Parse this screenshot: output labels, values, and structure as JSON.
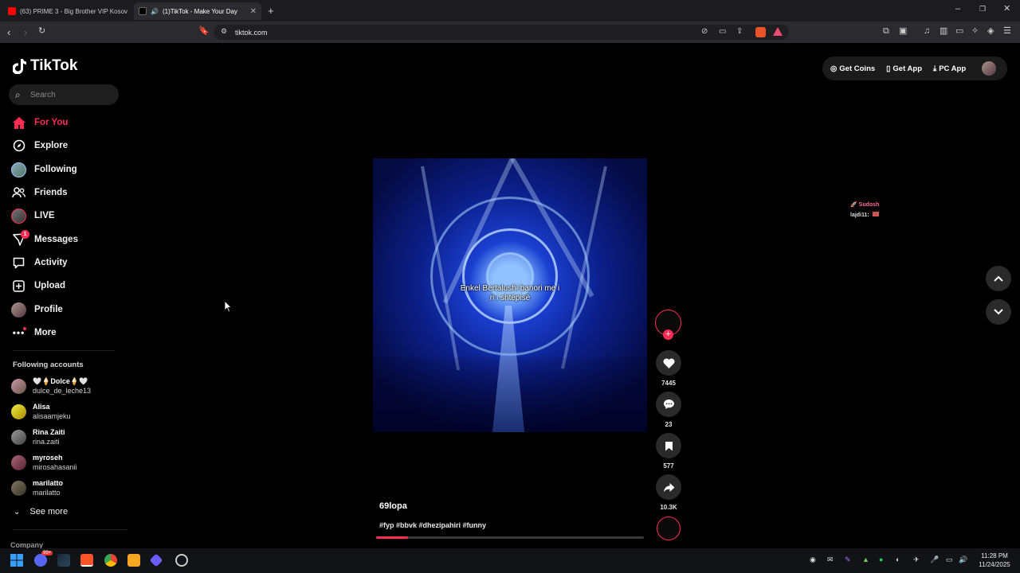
{
  "browser": {
    "tabs": [
      {
        "title": "(63) PRIME 3 - Big Brother VIP Kosov",
        "active": false
      },
      {
        "title": "(1)TikTok - Make Your Day",
        "active": true
      }
    ],
    "new_tab_icon": "plus-icon",
    "url": "tiktok.com",
    "window_controls": [
      "minimize-icon",
      "restore-icon",
      "close-icon"
    ]
  },
  "tiktok": {
    "logo_text": "TikTok",
    "search_placeholder": "Search",
    "nav": [
      {
        "label": "For You",
        "icon": "home-icon",
        "active": true
      },
      {
        "label": "Explore",
        "icon": "compass-icon"
      },
      {
        "label": "Following",
        "icon": "avatar-icon"
      },
      {
        "label": "Friends",
        "icon": "friends-icon"
      },
      {
        "label": "LIVE",
        "icon": "live-avatar-icon"
      },
      {
        "label": "Messages",
        "icon": "messages-icon",
        "badge": "1"
      },
      {
        "label": "Activity",
        "icon": "activity-icon"
      },
      {
        "label": "Upload",
        "icon": "upload-icon"
      },
      {
        "label": "Profile",
        "icon": "profile-avatar-icon"
      },
      {
        "label": "More",
        "icon": "more-icon"
      }
    ],
    "following_header": "Following accounts",
    "accounts": [
      {
        "name": "🤍🍦Dolce🍦🤍",
        "username": "dulce_de_leche13"
      },
      {
        "name": "Alisa",
        "username": "alisaamjeku"
      },
      {
        "name": "Rina Zaiti",
        "username": "rina.zaiti"
      },
      {
        "name": "myroseh",
        "username": "mirosahasanii"
      },
      {
        "name": "marilatto",
        "username": "marilatto"
      }
    ],
    "see_more": "See more",
    "company": "Company",
    "top_buttons": [
      {
        "label": "Get Coins",
        "icon": "coin-icon"
      },
      {
        "label": "Get App",
        "icon": "phone-icon"
      },
      {
        "label": "PC App",
        "icon": "download-icon"
      }
    ],
    "video": {
      "subtitle_line1": "Enkel Bertalushi banori me i",
      "subtitle_line2": "ri i shtëpisë",
      "author": "69lopa",
      "hashtags": "#fyp #bbvk #dhezipahiri #funny",
      "progress": 0.12
    },
    "actions": {
      "likes": "7445",
      "comments": "23",
      "saves": "577",
      "shares": "10.3K"
    },
    "live_comments": [
      {
        "user": "Sudosh",
        "text": ""
      },
      {
        "user": "lajdi11:",
        "text": ""
      }
    ]
  },
  "taskbar": {
    "time": "11:28 PM",
    "date": "11/24/2025",
    "discord_badge": "99+"
  },
  "colors": {
    "accent": "#fe2c55",
    "background": "#000000"
  }
}
